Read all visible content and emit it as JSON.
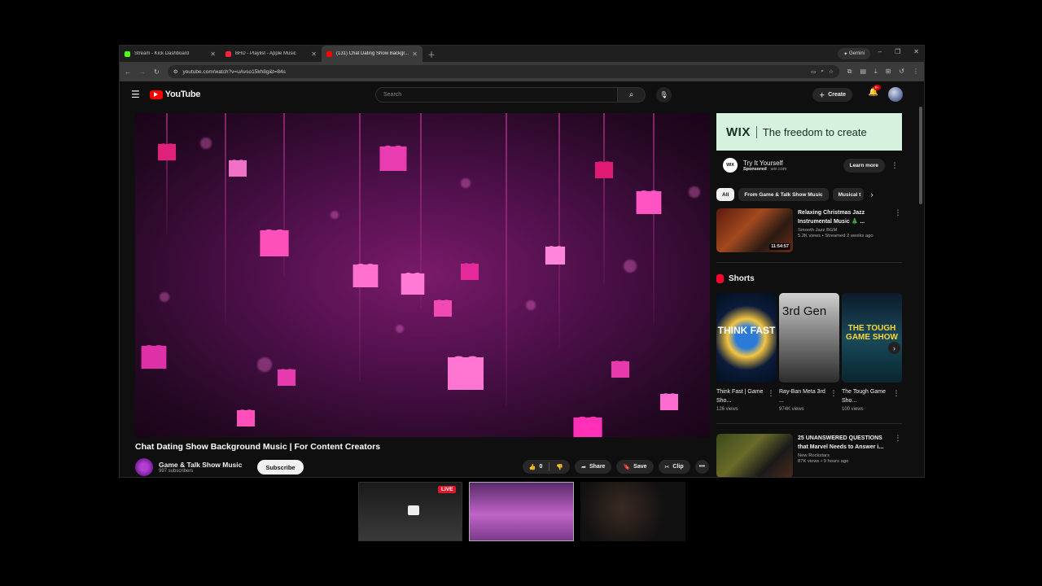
{
  "browser": {
    "tabs": [
      {
        "title": "Stream - Kick Dashboard",
        "color": "#53fc18"
      },
      {
        "title": "BHD - Playlist - Apple Music",
        "color": "#fa243c"
      },
      {
        "title": "(131) Chat Dating Show Backgr...",
        "color": "#ff0000",
        "active": true
      }
    ],
    "gemini_label": "Gemini",
    "url": "youtube.com/watch?v=uAvso15kh8g&t=84s"
  },
  "youtube": {
    "logo_text": "YouTube",
    "search_placeholder": "Search",
    "create_label": "Create",
    "notifications_badge": "9+"
  },
  "video": {
    "title": "Chat Dating Show Background Music | For Content Creators",
    "channel": "Game & Talk Show Music",
    "subscribers": "997 subscribers",
    "subscribe_label": "Subscribe",
    "likes": "0",
    "share_label": "Share",
    "save_label": "Save",
    "clip_label": "Clip"
  },
  "ad": {
    "brand": "WIX",
    "tagline": "The freedom to create",
    "title": "Try It Yourself",
    "sponsored": "Sponsored",
    "domain": "wix.com",
    "cta": "Learn more"
  },
  "chips": [
    "All",
    "From Game & Talk Show Music",
    "Musical t"
  ],
  "recommended": [
    {
      "title": "Relaxing Christmas Jazz Instrumental Music 🎄 ...",
      "channel": "Smooth Jazz BGM",
      "meta": "5.2K views • Streamed 2 weeks ago",
      "duration": "11:54:57"
    },
    {
      "title": "25 UNANSWERED QUESTIONS that Marvel Needs to Answer i...",
      "channel": "New Rockstars",
      "meta": "87K views • 9 hours ago",
      "duration": ""
    }
  ],
  "shorts": {
    "heading": "Shorts",
    "items": [
      {
        "title": "Think Fast | Game Sho...",
        "views": "126 views",
        "overlay": "THINK FAST"
      },
      {
        "title": "Ray-Ban Meta 3rd ...",
        "views": "974K views",
        "overlay": "3rd Gen"
      },
      {
        "title": "The Tough Game Sho...",
        "views": "100 views",
        "overlay": "THE TOUGH GAME SHOW"
      }
    ]
  },
  "stream_strip": {
    "live_label": "LIVE"
  }
}
